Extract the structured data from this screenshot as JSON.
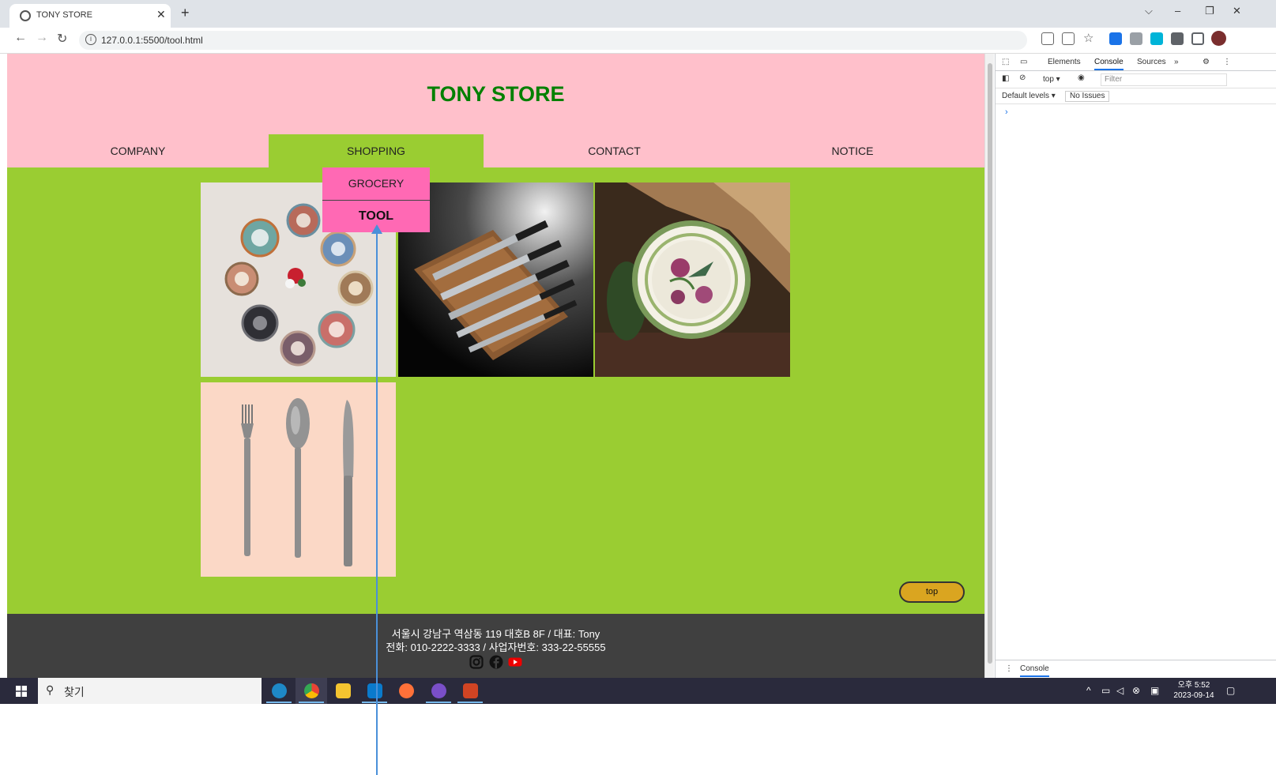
{
  "browser": {
    "tab_title": "TONY STORE",
    "tab_close": "✕",
    "new_tab": "+",
    "url": "127.0.0.1:5500/tool.html",
    "win_dropdown": "⌵",
    "win_minimize": "–",
    "win_restore": "❐",
    "win_close": "✕"
  },
  "site": {
    "title": "TONY STORE",
    "nav": [
      "COMPANY",
      "SHOPPING",
      "CONTACT",
      "NOTICE"
    ],
    "dropdown": [
      "GROCERY",
      "TOOL"
    ],
    "top_button": "top",
    "footer": {
      "address": "서울시 강남구 역삼동 119 대호B 8F / 대표: Tony",
      "contact": "전화: 010-2222-3333 / 사업자번호: 333-22-55555"
    }
  },
  "devtools": {
    "tabs": [
      "Elements",
      "Console",
      "Sources"
    ],
    "more": "»",
    "context": "top ▾",
    "filter_placeholder": "Filter",
    "levels": "Default levels ▾",
    "issues": "No Issues",
    "prompt": "›",
    "drawer_tab": "Console"
  },
  "taskbar": {
    "search": "찾기",
    "clock_time": "오후 5:52",
    "clock_date": "2023-09-14"
  },
  "colors": {
    "header_bg": "#ffc0cb",
    "title_color": "#008000",
    "content_bg": "#9acd32",
    "dropdown_bg": "#ff69b4",
    "footer_bg": "#404040",
    "top_button_bg": "#daa520"
  }
}
